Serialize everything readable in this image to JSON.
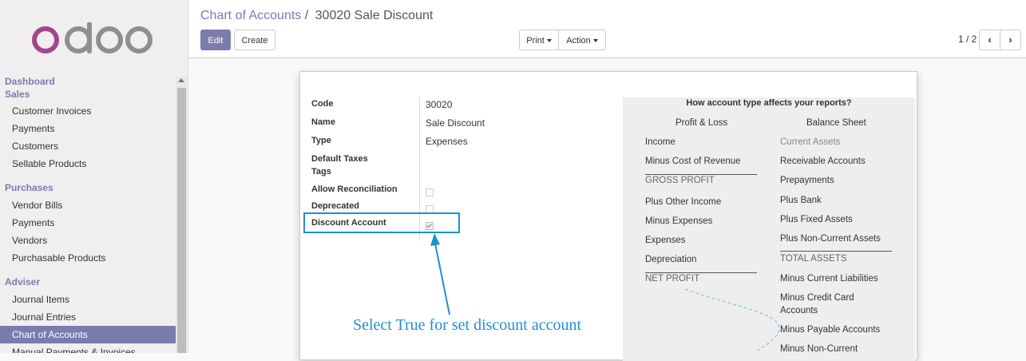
{
  "logo": {
    "text": "odoo"
  },
  "sidebar": {
    "sections": [
      {
        "title": "Dashboard",
        "items": []
      },
      {
        "title": "Sales",
        "items": [
          "Customer Invoices",
          "Payments",
          "Customers",
          "Sellable Products"
        ]
      },
      {
        "title": "Purchases",
        "items": [
          "Vendor Bills",
          "Payments",
          "Vendors",
          "Purchasable Products"
        ]
      },
      {
        "title": "Adviser",
        "items": [
          "Journal Items",
          "Journal Entries",
          "Chart of Accounts",
          "Manual Payments & Invoices ..."
        ]
      }
    ],
    "active_item": "Chart of Accounts"
  },
  "breadcrumb": {
    "parent": "Chart of Accounts",
    "separator": "/",
    "current": "30020 Sale Discount"
  },
  "toolbar": {
    "edit_label": "Edit",
    "create_label": "Create",
    "print_label": "Print",
    "action_label": "Action"
  },
  "pager": {
    "value": "1 / 2"
  },
  "form": {
    "code": {
      "label": "Code",
      "value": "30020"
    },
    "name": {
      "label": "Name",
      "value": "Sale Discount"
    },
    "type": {
      "label": "Type",
      "value": "Expenses"
    },
    "default_taxes": {
      "label": "Default Taxes"
    },
    "tags": {
      "label": "Tags"
    },
    "allow_reconciliation": {
      "label": "Allow Reconciliation",
      "checked": false
    },
    "deprecated": {
      "label": "Deprecated",
      "checked": false
    },
    "discount_account": {
      "label": "Discount Account",
      "checked": true
    }
  },
  "info_panel": {
    "title": "How account type affects your reports?",
    "profit_loss": {
      "heading": "Profit & Loss",
      "items": [
        "Income",
        "Minus Cost of Revenue",
        "GROSS PROFIT",
        "Plus Other Income",
        "Minus Expenses",
        "Expenses",
        "Depreciation",
        "NET PROFIT"
      ]
    },
    "balance_sheet": {
      "heading": "Balance Sheet",
      "items": [
        "Current Assets",
        "Receivable Accounts",
        "Prepayments",
        "Plus Bank",
        "Plus Fixed Assets",
        "Plus Non-Current Assets",
        "TOTAL ASSETS",
        "Minus Current Liabilities",
        "Minus Credit Card Accounts",
        "Minus Payable Accounts",
        "Minus Non-Current"
      ]
    }
  },
  "annotation": {
    "text": "Select True for set discount account"
  },
  "colors": {
    "brand": "#7c7bad",
    "annotation": "#1e90d0",
    "logo_pink": "#a24689",
    "logo_gray": "#8f8f8f"
  }
}
